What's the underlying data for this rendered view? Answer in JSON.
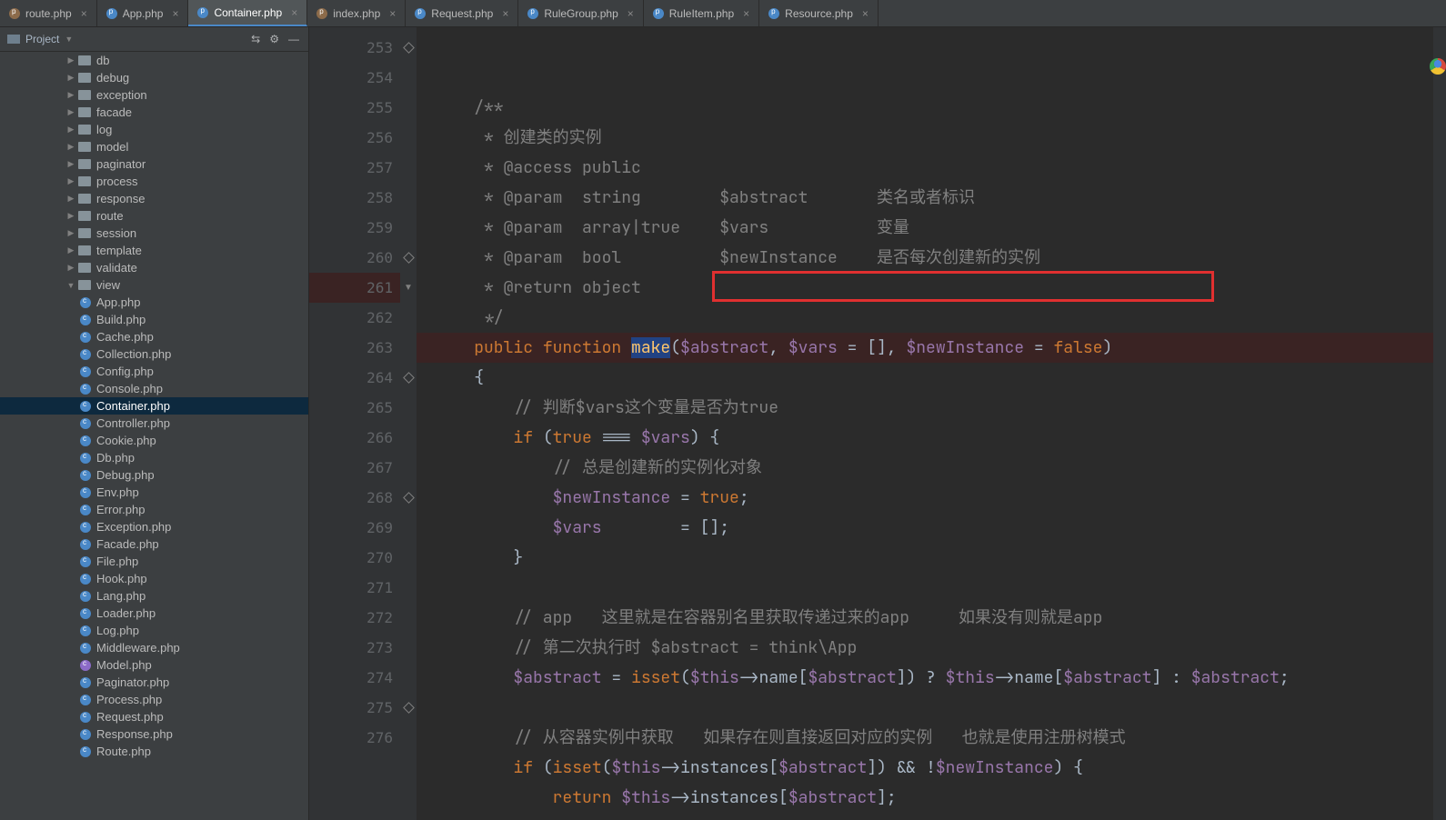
{
  "tabs": [
    {
      "label": "route.php",
      "iconClass": "brown"
    },
    {
      "label": "App.php",
      "iconClass": ""
    },
    {
      "label": "Container.php",
      "iconClass": "",
      "active": true
    },
    {
      "label": "index.php",
      "iconClass": "brown"
    },
    {
      "label": "Request.php",
      "iconClass": ""
    },
    {
      "label": "RuleGroup.php",
      "iconClass": ""
    },
    {
      "label": "RuleItem.php",
      "iconClass": ""
    },
    {
      "label": "Resource.php",
      "iconClass": ""
    }
  ],
  "sidebar": {
    "title": "Project"
  },
  "folders": [
    "db",
    "debug",
    "exception",
    "facade",
    "log",
    "model",
    "paginator",
    "process",
    "response",
    "route",
    "session",
    "template",
    "validate"
  ],
  "openFolder": "view",
  "files": [
    "App.php",
    "Build.php",
    "Cache.php",
    "Collection.php",
    "Config.php",
    "Console.php",
    "Container.php",
    "Controller.php",
    "Cookie.php",
    "Db.php",
    "Debug.php",
    "Env.php",
    "Error.php",
    "Exception.php",
    "Facade.php",
    "File.php",
    "Hook.php",
    "Lang.php",
    "Loader.php",
    "Log.php",
    "Middleware.php",
    "Model.php",
    "Paginator.php",
    "Process.php",
    "Request.php",
    "Response.php",
    "Route.php"
  ],
  "selectedFile": "Container.php",
  "lines": {
    "253": {
      "cmt": "/**"
    },
    "254": {
      "cmt": " * 创建类的实例"
    },
    "255": {
      "cmt": " * @access public"
    },
    "256": {
      "cmt": " * @param  string        $abstract       类名或者标识"
    },
    "257": {
      "cmt": " * @param  array|true    $vars           变量"
    },
    "258": {
      "cmt": " * @param  bool          $newInstance    是否每次创建新的实例"
    },
    "259": {
      "cmt": " * @return object"
    },
    "260": {
      "cmt": " */"
    },
    "261": {
      "kw1": "public ",
      "kw2": "function ",
      "fn": "make",
      "p1": "(",
      "v1": "$abstract",
      "c1": ", ",
      "v2": "$vars",
      "eq1": " = [], ",
      "v3": "$newInstance",
      "eq2": " = ",
      "bool": "false",
      "p2": ")"
    },
    "262": {
      "txt": "{"
    },
    "263": {
      "cmt": "// 判断$vars这个变量是否为true"
    },
    "264": {
      "kw": "if ",
      "p1": "(",
      "bool1": "true",
      "op": " === ",
      "v": "$vars",
      "p2": ") {"
    },
    "265": {
      "cmt": "// 总是创建新的实例化对象"
    },
    "266": {
      "v": "$newInstance",
      "op": " = ",
      "bool": "true",
      "semi": ";"
    },
    "267": {
      "v": "$vars",
      "sp": "        ",
      "op": "= []",
      "semi": ";"
    },
    "268": {
      "txt": "}"
    },
    "270": {
      "cmt": "// app   这里就是在容器别名里获取传递过来的app     如果没有则就是app"
    },
    "271": {
      "cmt": "// 第二次执行时 $abstract = think\\App"
    },
    "272": {
      "v1": "$abstract",
      "op1": " = ",
      "kw": "isset",
      "p1": "(",
      "v2": "$this",
      "arr": "->",
      "id1": "name",
      "br1": "[",
      "v3": "$abstract",
      "br2": "]) ? ",
      "v4": "$this",
      "arr2": "->",
      "id2": "name",
      "br3": "[",
      "v5": "$abstract",
      "br4": "]",
      " cln": " : ",
      "v6": "$abstract",
      "semi": ";"
    },
    "274": {
      "cmt": "// 从容器实例中获取   如果存在则直接返回对应的实例   也就是使用注册树模式"
    },
    "275": {
      "kw": "if ",
      "p1": "(",
      "kw2": "isset",
      "p2": "(",
      "v1": "$this",
      "arr": "->",
      "id": "instances",
      "br1": "[",
      "v2": "$abstract",
      "br2": "]) && !",
      "v3": "$newInstance",
      "p3": ") {"
    },
    "276": {
      "kw": "return ",
      "v1": "$this",
      "arr": "->",
      "id": "instances",
      "br1": "[",
      "v2": "$abstract",
      "br2": "];"
    }
  },
  "lineNumbers": [
    "253",
    "254",
    "255",
    "256",
    "257",
    "258",
    "259",
    "260",
    "261",
    "262",
    "263",
    "264",
    "265",
    "266",
    "267",
    "268",
    "269",
    "270",
    "271",
    "272",
    "273",
    "274",
    "275",
    "276"
  ]
}
